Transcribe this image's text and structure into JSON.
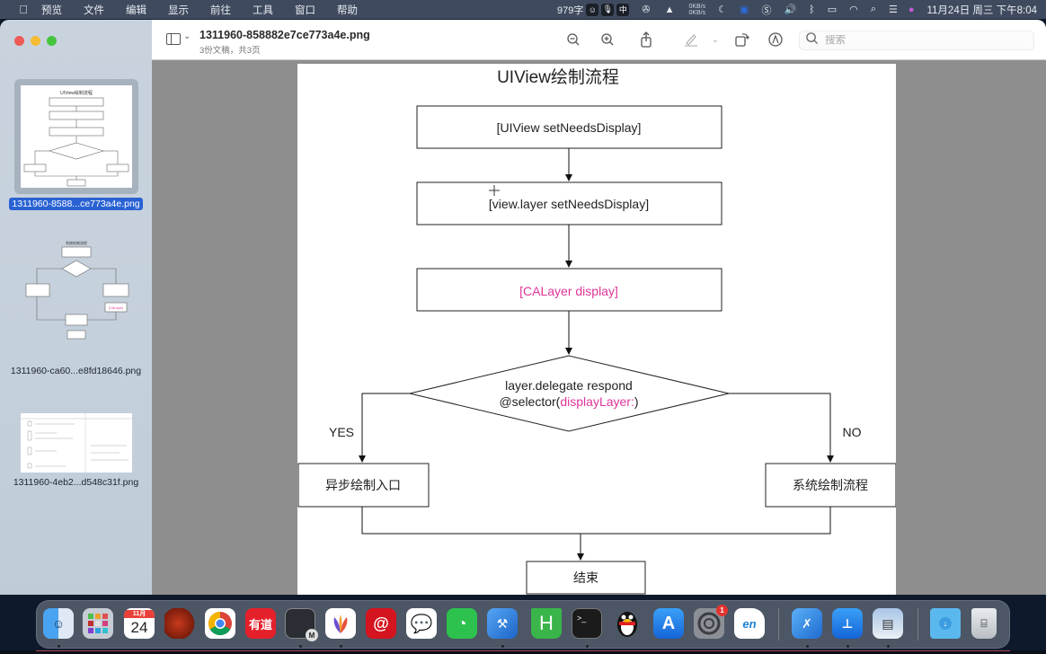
{
  "menubar": {
    "apple_icon": "apple-logo-icon",
    "items": [
      "预览",
      "文件",
      "编辑",
      "显示",
      "前往",
      "工具",
      "窗口",
      "帮助"
    ],
    "status": {
      "word_count": "979字",
      "input_method": "中",
      "net_up": "0KB/s",
      "net_down": "0KB/s",
      "datetime": "11月24日 周三 下午8:04"
    }
  },
  "window": {
    "title": "1311960-858882e7ce773a4e.png",
    "subtitle": "3份文稿，共3页",
    "search_placeholder": "搜索",
    "search_value": "",
    "toolbar_icons": [
      "sidebar-toggle-icon",
      "zoom-out-icon",
      "zoom-in-icon",
      "share-icon",
      "markup-pen-icon",
      "rotate-icon",
      "annotate-icon",
      "search-icon"
    ]
  },
  "sidebar": {
    "thumbnails": [
      {
        "caption": "1311960-8588...ce773a4e.png",
        "selected": true
      },
      {
        "caption": "1311960-ca60...e8fd18646.png",
        "selected": false
      },
      {
        "caption": "1311960-4eb2...d548c31f.png",
        "selected": false
      }
    ]
  },
  "diagram": {
    "title": "UIView绘制流程",
    "nodes": {
      "step1": "[UIView setNeedsDisplay]",
      "step2": "[view.layer setNeedsDisplay]",
      "step3": "[CALayer display]",
      "decision_line1": "layer.delegate respond",
      "decision_line2_prefix": "@selector(",
      "decision_line2_highlight": "displayLayer:",
      "decision_line2_suffix": ")",
      "yes_branch": "异步绘制入口",
      "no_branch": "系统绘制流程",
      "end": "结束"
    },
    "edge_labels": {
      "yes": "YES",
      "no": "NO"
    },
    "highlight_color": "#e0359a"
  },
  "dock": {
    "apps": [
      {
        "name": "finder",
        "label": ""
      },
      {
        "name": "launchpad",
        "label": ""
      },
      {
        "name": "calendar",
        "month": "11月",
        "day": "24"
      },
      {
        "name": "apple-red",
        "label": ""
      },
      {
        "name": "chrome",
        "label": ""
      },
      {
        "name": "youdao",
        "label": "有道"
      },
      {
        "name": "code-editor",
        "label": "M"
      },
      {
        "name": "mindnode",
        "label": ""
      },
      {
        "name": "netease-music",
        "label": ""
      },
      {
        "name": "dingtalk-chat",
        "label": ""
      },
      {
        "name": "wechat",
        "label": ""
      },
      {
        "name": "xcode",
        "label": ""
      },
      {
        "name": "hbuilder",
        "label": "H"
      },
      {
        "name": "terminal",
        "label": ">_"
      },
      {
        "name": "qq",
        "label": ""
      },
      {
        "name": "app-store",
        "label": ""
      },
      {
        "name": "system-preferences",
        "badge": "1"
      },
      {
        "name": "eudic",
        "label": "en"
      },
      {
        "name": "instruments",
        "label": ""
      },
      {
        "name": "keynote",
        "label": ""
      },
      {
        "name": "preview",
        "label": ""
      },
      {
        "name": "downloads",
        "label": ""
      },
      {
        "name": "trash",
        "label": ""
      }
    ]
  }
}
